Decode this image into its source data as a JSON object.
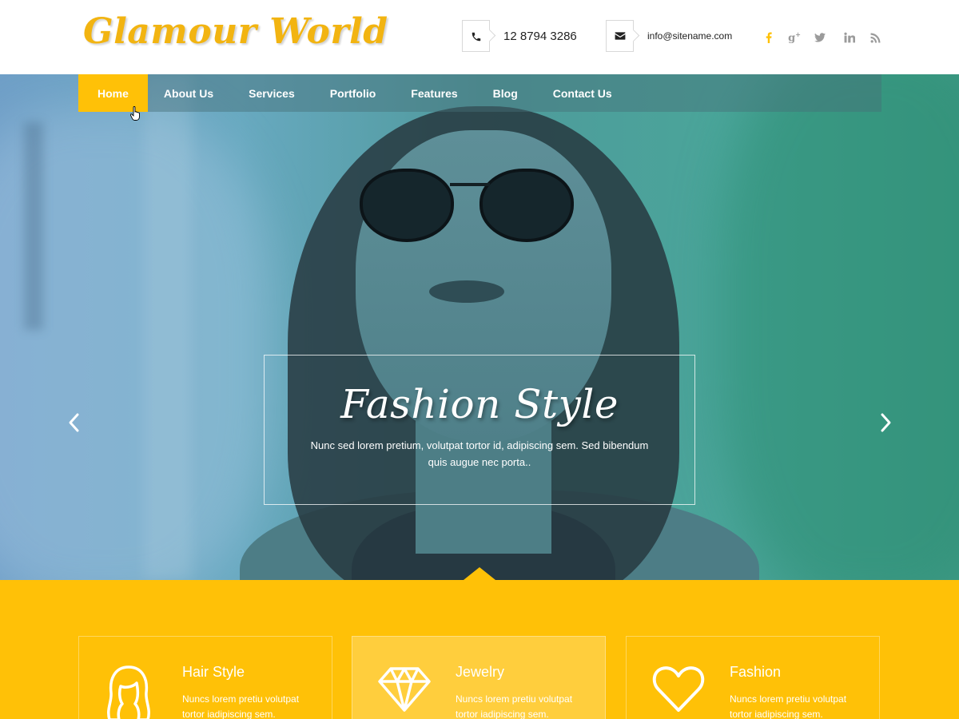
{
  "brand": {
    "logo_text": "Glamour World",
    "accent_color": "#ffc107",
    "logo_color": "#f2b411"
  },
  "header": {
    "phone": {
      "icon": "phone-icon",
      "text": "12 8794 3286"
    },
    "email": {
      "icon": "envelope-icon",
      "text": "info@sitename.com"
    },
    "social": [
      {
        "name": "facebook-icon",
        "glyph": "f"
      },
      {
        "name": "google-plus-icon",
        "glyph": "g+"
      },
      {
        "name": "twitter-icon",
        "glyph": "t"
      },
      {
        "name": "linkedin-icon",
        "glyph": "in"
      },
      {
        "name": "rss-icon",
        "glyph": "rss"
      }
    ]
  },
  "nav": {
    "items": [
      {
        "label": "Home",
        "active": true
      },
      {
        "label": "About Us"
      },
      {
        "label": "Services"
      },
      {
        "label": "Portfolio"
      },
      {
        "label": "Features"
      },
      {
        "label": "Blog"
      },
      {
        "label": "Contact Us"
      }
    ]
  },
  "slider": {
    "title": "Fashion Style",
    "text": "Nunc sed lorem pretium, volutpat tortor id, adipiscing sem. Sed bibendum quis augue nec porta..",
    "prev_icon": "chevron-left-icon",
    "next_icon": "chevron-right-icon"
  },
  "features": [
    {
      "icon": "hair-style-icon",
      "title": "Hair Style",
      "text": "Nuncs lorem pretiu volutpat tortor iadipiscing sem."
    },
    {
      "icon": "diamond-icon",
      "title": "Jewelry",
      "text": "Nuncs lorem pretiu volutpat tortor iadipiscing sem."
    },
    {
      "icon": "heart-icon",
      "title": "Fashion",
      "text": "Nuncs lorem pretiu volutpat tortor iadipiscing sem."
    }
  ]
}
